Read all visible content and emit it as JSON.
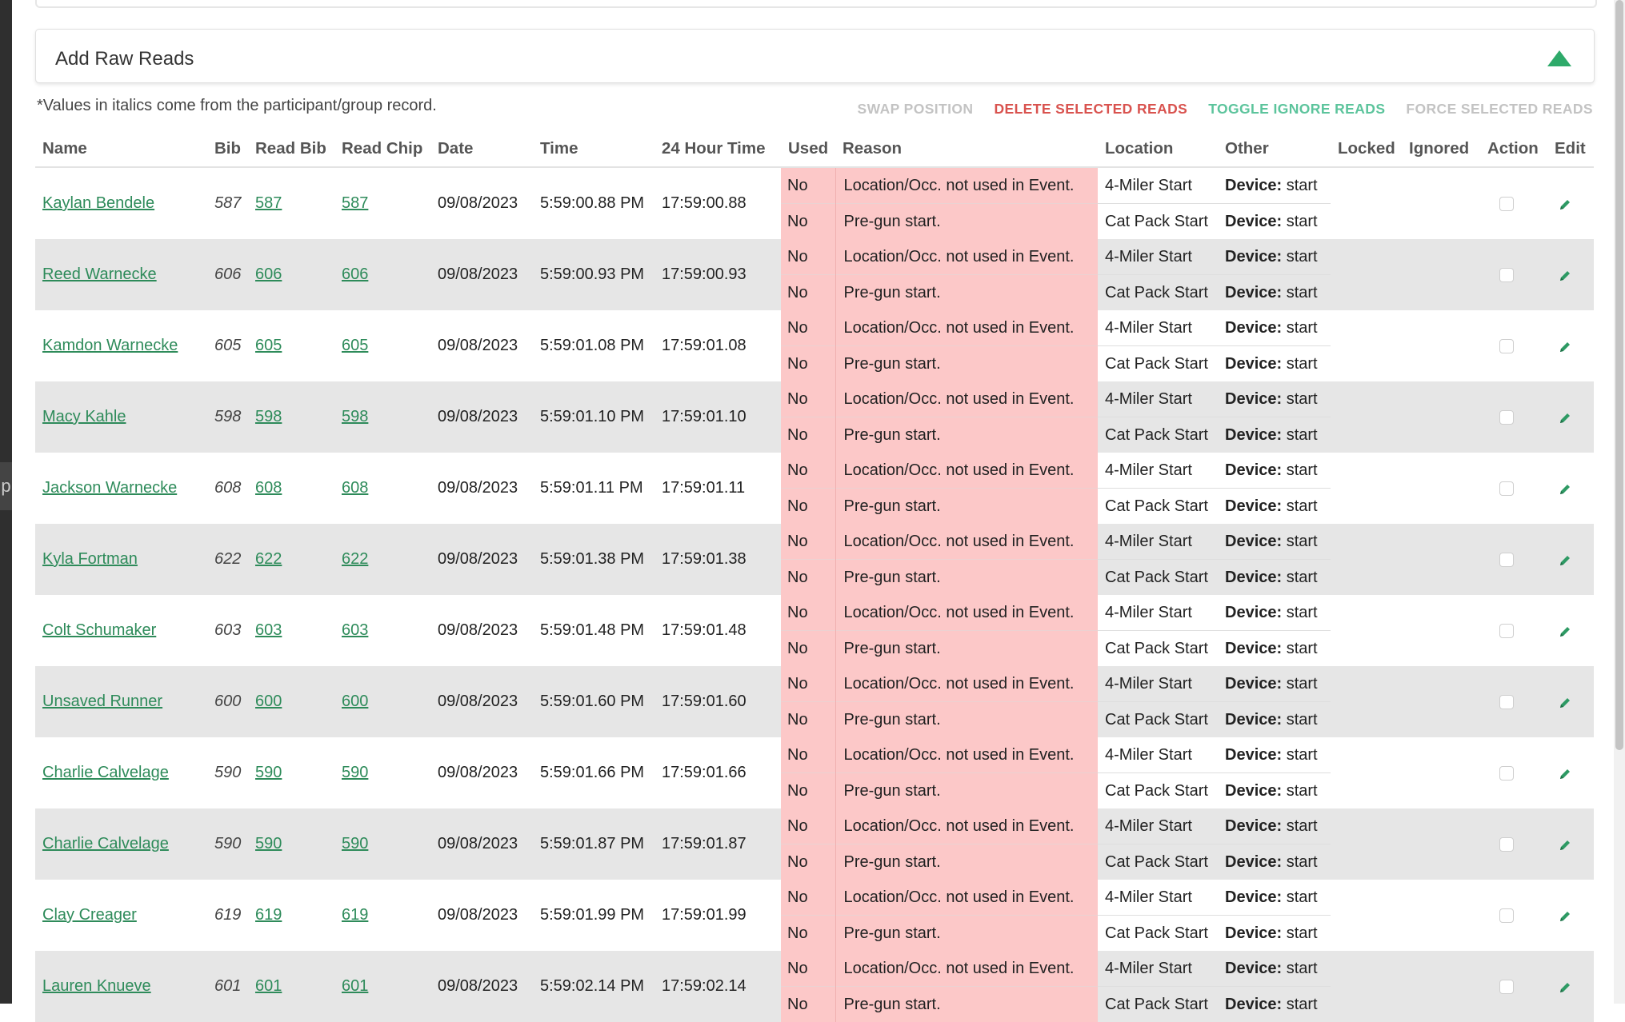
{
  "panel": {
    "title": "Add Raw Reads",
    "collapse_icon": "triangle-up-icon",
    "accent_color": "#2eaa6a"
  },
  "note": "*Values in italics come from the participant/group record.",
  "actions": {
    "swap": "SWAP POSITION",
    "delete": "DELETE SELECTED READS",
    "toggle": "TOGGLE IGNORE READS",
    "force": "FORCE SELECTED READS"
  },
  "columns": [
    "Name",
    "Bib",
    "Read Bib",
    "Read Chip",
    "Date",
    "Time",
    "24 Hour Time",
    "Used",
    "Reason",
    "Location",
    "Other",
    "Locked",
    "Ignored",
    "Action",
    "Edit"
  ],
  "device_label": "Device:",
  "rows": [
    {
      "name": "Kaylan Bendele",
      "bib": "587",
      "read_bib": "587",
      "read_chip": "587",
      "date": "09/08/2023",
      "time": "5:59:00.88 PM",
      "time24": "17:59:00.88",
      "reads": [
        {
          "used": "No",
          "reason": "Location/Occ. not used in Event.",
          "location": "4-Miler Start",
          "other": "start"
        },
        {
          "used": "No",
          "reason": "Pre-gun start.",
          "location": "Cat Pack Start",
          "other": "start"
        }
      ]
    },
    {
      "name": "Reed Warnecke",
      "bib": "606",
      "read_bib": "606",
      "read_chip": "606",
      "date": "09/08/2023",
      "time": "5:59:00.93 PM",
      "time24": "17:59:00.93",
      "reads": [
        {
          "used": "No",
          "reason": "Location/Occ. not used in Event.",
          "location": "4-Miler Start",
          "other": "start"
        },
        {
          "used": "No",
          "reason": "Pre-gun start.",
          "location": "Cat Pack Start",
          "other": "start"
        }
      ]
    },
    {
      "name": "Kamdon Warnecke",
      "bib": "605",
      "read_bib": "605",
      "read_chip": "605",
      "date": "09/08/2023",
      "time": "5:59:01.08 PM",
      "time24": "17:59:01.08",
      "reads": [
        {
          "used": "No",
          "reason": "Location/Occ. not used in Event.",
          "location": "4-Miler Start",
          "other": "start"
        },
        {
          "used": "No",
          "reason": "Pre-gun start.",
          "location": "Cat Pack Start",
          "other": "start"
        }
      ]
    },
    {
      "name": "Macy Kahle",
      "bib": "598",
      "read_bib": "598",
      "read_chip": "598",
      "date": "09/08/2023",
      "time": "5:59:01.10 PM",
      "time24": "17:59:01.10",
      "reads": [
        {
          "used": "No",
          "reason": "Location/Occ. not used in Event.",
          "location": "4-Miler Start",
          "other": "start"
        },
        {
          "used": "No",
          "reason": "Pre-gun start.",
          "location": "Cat Pack Start",
          "other": "start"
        }
      ]
    },
    {
      "name": "Jackson Warnecke",
      "bib": "608",
      "read_bib": "608",
      "read_chip": "608",
      "date": "09/08/2023",
      "time": "5:59:01.11 PM",
      "time24": "17:59:01.11",
      "reads": [
        {
          "used": "No",
          "reason": "Location/Occ. not used in Event.",
          "location": "4-Miler Start",
          "other": "start"
        },
        {
          "used": "No",
          "reason": "Pre-gun start.",
          "location": "Cat Pack Start",
          "other": "start"
        }
      ]
    },
    {
      "name": "Kyla Fortman",
      "bib": "622",
      "read_bib": "622",
      "read_chip": "622",
      "date": "09/08/2023",
      "time": "5:59:01.38 PM",
      "time24": "17:59:01.38",
      "reads": [
        {
          "used": "No",
          "reason": "Location/Occ. not used in Event.",
          "location": "4-Miler Start",
          "other": "start"
        },
        {
          "used": "No",
          "reason": "Pre-gun start.",
          "location": "Cat Pack Start",
          "other": "start"
        }
      ]
    },
    {
      "name": "Colt Schumaker",
      "bib": "603",
      "read_bib": "603",
      "read_chip": "603",
      "date": "09/08/2023",
      "time": "5:59:01.48 PM",
      "time24": "17:59:01.48",
      "reads": [
        {
          "used": "No",
          "reason": "Location/Occ. not used in Event.",
          "location": "4-Miler Start",
          "other": "start"
        },
        {
          "used": "No",
          "reason": "Pre-gun start.",
          "location": "Cat Pack Start",
          "other": "start"
        }
      ]
    },
    {
      "name": "Unsaved Runner",
      "bib": "600",
      "read_bib": "600",
      "read_chip": "600",
      "date": "09/08/2023",
      "time": "5:59:01.60 PM",
      "time24": "17:59:01.60",
      "reads": [
        {
          "used": "No",
          "reason": "Location/Occ. not used in Event.",
          "location": "4-Miler Start",
          "other": "start"
        },
        {
          "used": "No",
          "reason": "Pre-gun start.",
          "location": "Cat Pack Start",
          "other": "start"
        }
      ]
    },
    {
      "name": "Charlie Calvelage",
      "bib": "590",
      "read_bib": "590",
      "read_chip": "590",
      "date": "09/08/2023",
      "time": "5:59:01.66 PM",
      "time24": "17:59:01.66",
      "reads": [
        {
          "used": "No",
          "reason": "Location/Occ. not used in Event.",
          "location": "4-Miler Start",
          "other": "start"
        },
        {
          "used": "No",
          "reason": "Pre-gun start.",
          "location": "Cat Pack Start",
          "other": "start"
        }
      ]
    },
    {
      "name": "Charlie Calvelage",
      "bib": "590",
      "read_bib": "590",
      "read_chip": "590",
      "date": "09/08/2023",
      "time": "5:59:01.87 PM",
      "time24": "17:59:01.87",
      "reads": [
        {
          "used": "No",
          "reason": "Location/Occ. not used in Event.",
          "location": "4-Miler Start",
          "other": "start"
        },
        {
          "used": "No",
          "reason": "Pre-gun start.",
          "location": "Cat Pack Start",
          "other": "start"
        }
      ]
    },
    {
      "name": "Clay Creager",
      "bib": "619",
      "read_bib": "619",
      "read_chip": "619",
      "date": "09/08/2023",
      "time": "5:59:01.99 PM",
      "time24": "17:59:01.99",
      "reads": [
        {
          "used": "No",
          "reason": "Location/Occ. not used in Event.",
          "location": "4-Miler Start",
          "other": "start"
        },
        {
          "used": "No",
          "reason": "Pre-gun start.",
          "location": "Cat Pack Start",
          "other": "start"
        }
      ]
    },
    {
      "name": "Lauren Knueve",
      "bib": "601",
      "read_bib": "601",
      "read_chip": "601",
      "date": "09/08/2023",
      "time": "5:59:02.14 PM",
      "time24": "17:59:02.14",
      "reads": [
        {
          "used": "No",
          "reason": "Location/Occ. not used in Event.",
          "location": "4-Miler Start",
          "other": "start"
        },
        {
          "used": "No",
          "reason": "Pre-gun start.",
          "location": "Cat Pack Start",
          "other": "start"
        }
      ]
    }
  ]
}
